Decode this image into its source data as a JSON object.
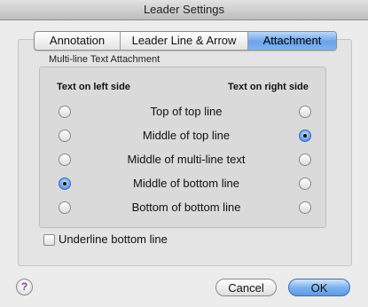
{
  "window": {
    "title": "Leader Settings"
  },
  "tabs": [
    {
      "label": "Annotation",
      "active": false
    },
    {
      "label": "Leader Line & Arrow",
      "active": false
    },
    {
      "label": "Attachment",
      "active": true
    }
  ],
  "attachment": {
    "group_title": "Multi-line Text Attachment",
    "left_header": "Text on left side",
    "right_header": "Text on right side",
    "rows": [
      {
        "label": "Top of top line",
        "left_selected": false,
        "right_selected": false
      },
      {
        "label": "Middle of top line",
        "left_selected": false,
        "right_selected": true
      },
      {
        "label": "Middle of multi-line text",
        "left_selected": false,
        "right_selected": false
      },
      {
        "label": "Middle of bottom line",
        "left_selected": true,
        "right_selected": false
      },
      {
        "label": "Bottom of bottom line",
        "left_selected": false,
        "right_selected": false
      }
    ],
    "underline_label": "Underline bottom line",
    "underline_checked": false
  },
  "footer": {
    "help_glyph": "?",
    "cancel_label": "Cancel",
    "ok_label": "OK"
  },
  "colors": {
    "accent": "#6aa4ea",
    "help_glyph": "#7a3fb8"
  }
}
